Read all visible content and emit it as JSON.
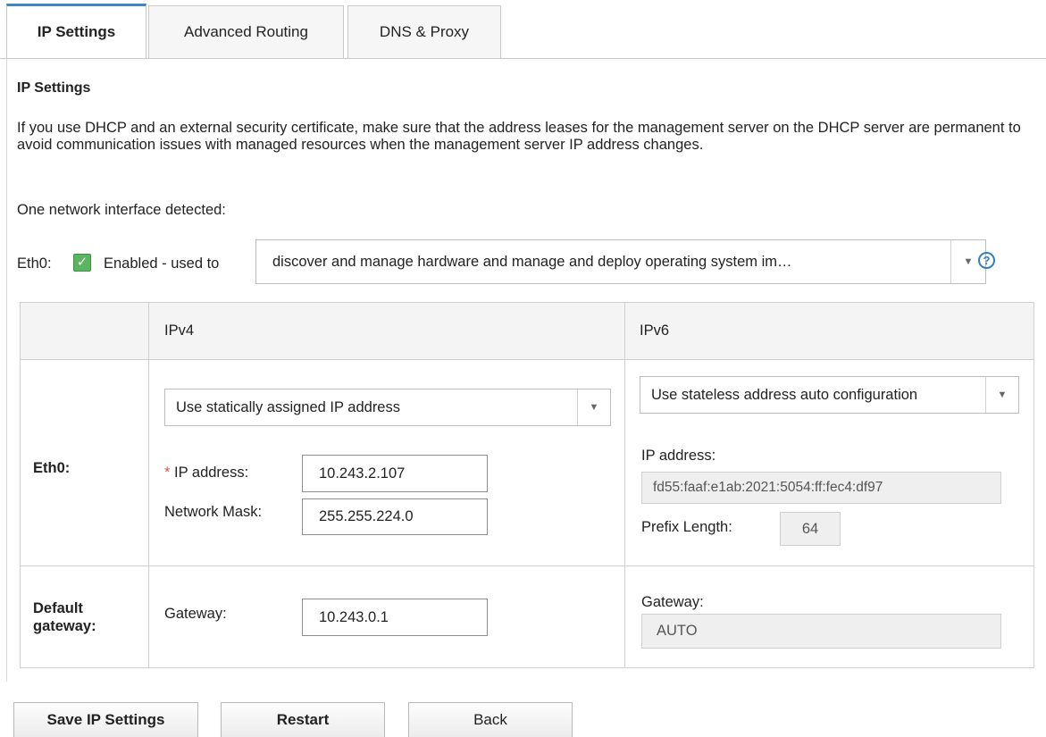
{
  "tabs": [
    {
      "label": "IP Settings",
      "active": true
    },
    {
      "label": "Advanced Routing",
      "active": false
    },
    {
      "label": "DNS & Proxy",
      "active": false
    }
  ],
  "section": {
    "title": "IP Settings",
    "description": "If you use DHCP and an external security certificate, make sure that the address leases for the management server on the DHCP server are permanent to avoid communication issues with managed resources when the management server IP address changes.",
    "detected": "One network interface detected:"
  },
  "interface": {
    "name": "Eth0:",
    "checkbox_checked": true,
    "enabled_label": "Enabled - used to",
    "usage_value": "discover and manage hardware and manage and deploy operating system im…",
    "help_glyph": "?"
  },
  "table": {
    "headers": [
      "",
      "IPv4",
      "IPv6"
    ],
    "rows": {
      "eth0_label": "Eth0:",
      "gateway_label_line1": "Default",
      "gateway_label_line2": "gateway:"
    },
    "ipv4": {
      "mode_value": "Use statically assigned IP address",
      "required_mark": "*",
      "ip_label": "IP address:",
      "ip_value": "10.243.2.107",
      "mask_label": "Network Mask:",
      "mask_value": "255.255.224.0",
      "gateway_label": "Gateway:",
      "gateway_value": "10.243.0.1"
    },
    "ipv6": {
      "mode_value": "Use stateless address auto configuration",
      "ip_label": "IP address:",
      "ip_value": "fd55:faaf:e1ab:2021:5054:ff:fec4:df97",
      "prefix_label": "Prefix Length:",
      "prefix_value": "64",
      "gateway_label": "Gateway:",
      "gateway_value": "AUTO"
    }
  },
  "buttons": {
    "save": "Save IP Settings",
    "restart": "Restart",
    "back": "Back"
  },
  "colors": {
    "accent": "#3c87c8",
    "checkbox": "#5bb45f",
    "required": "#d9534f"
  }
}
